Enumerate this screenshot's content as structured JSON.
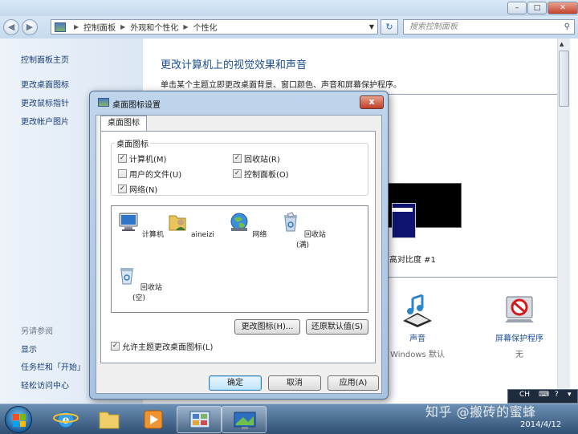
{
  "address": {
    "crumbs": [
      "控制面板",
      "外观和个性化",
      "个性化"
    ],
    "search_placeholder": "搜索控制面板"
  },
  "sidebar": {
    "home": "控制面板主页",
    "links": [
      "更改桌面图标",
      "更改鼠标指针",
      "更改帐户图片"
    ],
    "see_also_title": "另请参阅",
    "see_also": [
      "显示",
      "任务栏和「开始」",
      "轻松访问中心"
    ]
  },
  "main": {
    "title": "更改计算机上的视觉效果和声音",
    "subtitle": "单击某个主题立即更改桌面背景、窗口颜色、声音和屏幕保护程序。",
    "theme_name": "高对比度 #1",
    "bottom_items": [
      {
        "label": "声音",
        "sub": "Windows 默认"
      },
      {
        "label": "屏幕保护程序",
        "sub": "无"
      }
    ]
  },
  "dialog": {
    "title": "桌面图标设置",
    "close": "x",
    "tab": "桌面图标",
    "group_title": "桌面图标",
    "checkboxes": [
      {
        "label": "计算机(M)",
        "checked": true
      },
      {
        "label": "回收站(R)",
        "checked": true
      },
      {
        "label": "用户的文件(U)",
        "checked": false
      },
      {
        "label": "控制面板(O)",
        "checked": true
      },
      {
        "label": "网络(N)",
        "checked": true
      }
    ],
    "icons": [
      "计算机",
      "aineizi",
      "网络",
      "回收站(满)",
      "回收站(空)"
    ],
    "change_icon": "更改图标(H)...",
    "restore_default": "还原默认值(S)",
    "allow_themes": "允许主题更改桌面图标(L)",
    "ok": "确定",
    "cancel": "取消",
    "apply": "应用(A)"
  },
  "tray": {
    "lang": "CH"
  },
  "clock": {
    "date": "2014/4/12"
  },
  "watermark": "知乎 @搬砖的蜜蜂"
}
